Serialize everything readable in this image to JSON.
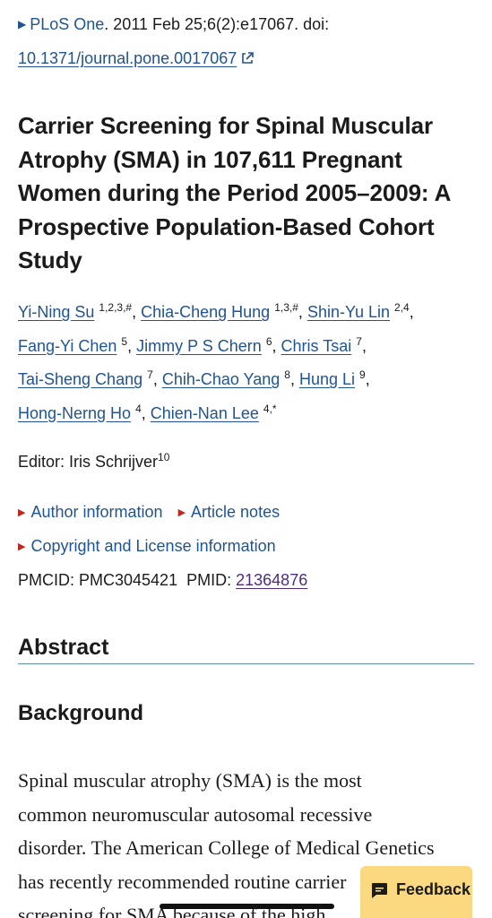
{
  "citation": {
    "journal": "PLoS One",
    "details": ". 2011 Feb 25;6(2):e17067. doi:",
    "doi": "10.1371/journal.pone.0017067"
  },
  "title": "Carrier Screening for Spinal Muscular Atrophy (SMA) in 107,611 Pregnant Women during the Period 2005–2009: A Prospective Population-Based Cohort Study",
  "authors": [
    {
      "name": "Yi-Ning Su",
      "aff": "1,2,3,#"
    },
    {
      "name": "Chia-Cheng Hung",
      "aff": "1,3,#"
    },
    {
      "name": "Shin-Yu Lin",
      "aff": "2,4"
    },
    {
      "name": "Fang-Yi Chen",
      "aff": "5"
    },
    {
      "name": "Jimmy P S Chern",
      "aff": "6"
    },
    {
      "name": "Chris Tsai",
      "aff": "7"
    },
    {
      "name": "Tai-Sheng Chang",
      "aff": "7"
    },
    {
      "name": "Chih-Chao Yang",
      "aff": "8"
    },
    {
      "name": "Hung Li",
      "aff": "9"
    },
    {
      "name": "Hong-Nerng Ho",
      "aff": "4"
    },
    {
      "name": "Chien-Nan Lee",
      "aff": "4,*"
    }
  ],
  "editor": {
    "label": "Editor: Iris Schrijver",
    "aff": "10"
  },
  "toggles": {
    "author_info": "Author information",
    "article_notes": "Article notes",
    "copyright": "Copyright and License information"
  },
  "ids": {
    "pmcid_label": "PMCID: PMC3045421",
    "pmid_label": "PMID:",
    "pmid": "21364876"
  },
  "abstract_heading": "Abstract",
  "background_heading": "Background",
  "abstract_lines": [
    "Spinal muscular atrophy (SMA) is the most",
    "common neuromuscular autosomal recessive",
    "disorder. The American College of Medical Genetics",
    "has recently recommended routine carrier",
    "screening for SMA because of the high"
  ],
  "feedback_label": "Feedback",
  "colors": {
    "link": "#205493",
    "toggle_marker": "#c0271e",
    "feedback_bg": "#fad980",
    "visited_link": "#4d2c82"
  }
}
